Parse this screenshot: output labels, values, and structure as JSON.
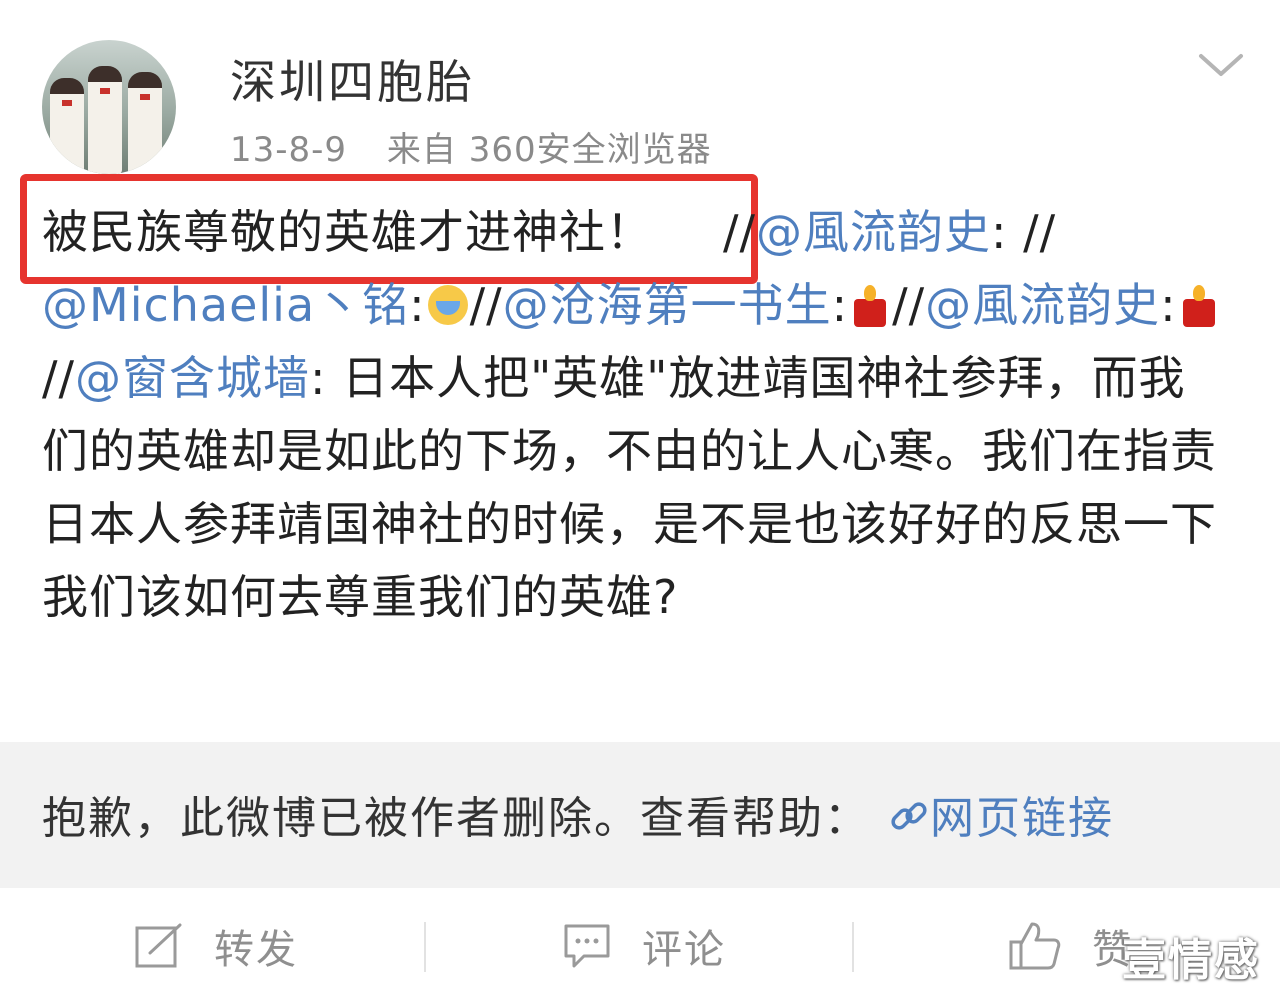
{
  "post": {
    "author": "深圳四胞胎",
    "date": "13-8-9",
    "source": "来自 360安全浏览器",
    "highlighted_text": "被民族尊敬的英雄才进神社！",
    "repost_chain": [
      {
        "prefix": "//",
        "mention": "@風流韵史",
        "suffix": ": //"
      },
      {
        "prefix": "",
        "mention": "@Michaelia丶铭",
        "suffix": ":",
        "emoji": "crying-face-emoji"
      },
      {
        "prefix": "//",
        "mention": "@沧海第一书生",
        "suffix": ":",
        "emoji": "candle-emoji"
      },
      {
        "prefix": "//",
        "mention": "@風流韵史",
        "suffix": ":",
        "emoji": "candle-emoji"
      },
      {
        "prefix": "//",
        "mention": "@窗含城墙",
        "suffix": ": "
      }
    ],
    "body": "日本人把\"英雄\"放进靖国神社参拜，而我们的英雄却是如此的下场，不由的让人心寒。我们在指责日本人参拜靖国神社的时候，是不是也该好好的反思一下我们该如何去尊重我们的英雄?"
  },
  "deleted_notice": {
    "text": "抱歉，此微博已被作者删除。查看帮助：",
    "link_label": "网页链接"
  },
  "actions": {
    "repost_label": "转发",
    "comment_label": "评论",
    "like_label": "赞"
  },
  "watermark": "壹情感",
  "colors": {
    "highlight_border": "#e6342e",
    "mention": "#4f7fbf",
    "deleted_bg": "#f2f2f2",
    "muted": "#8f8f8f"
  },
  "icons": [
    "chevron-down-icon",
    "edit-icon",
    "comment-icon",
    "thumbs-up-icon",
    "link-icon"
  ]
}
